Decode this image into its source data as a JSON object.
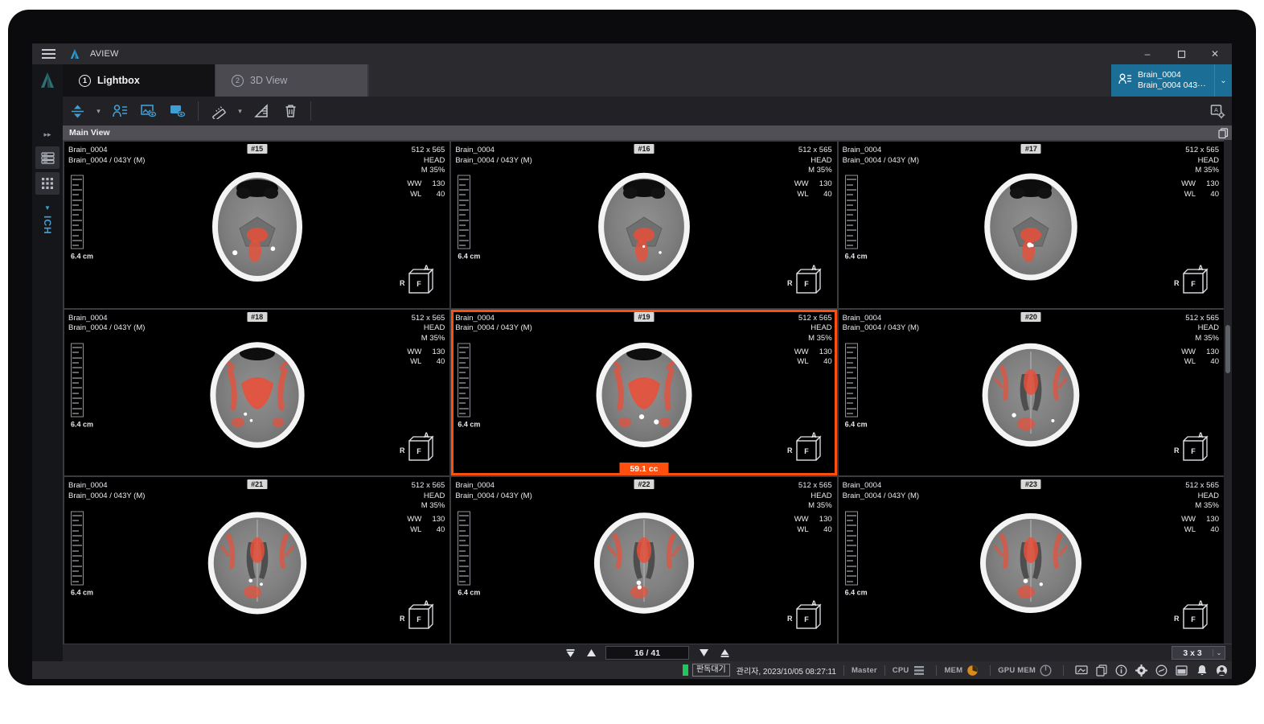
{
  "window": {
    "app_title": "AVIEW",
    "minimize": "–",
    "maximize": "❐",
    "close": "✕"
  },
  "tabs": [
    {
      "num": "1",
      "label": "Lightbox",
      "active": true
    },
    {
      "num": "2",
      "label": "3D View",
      "active": false
    }
  ],
  "patient_badge": {
    "line1": "Brain_0004",
    "line2": "Brain_0004 043···",
    "caret": "⌄"
  },
  "sidebar": {
    "expand": "▸▸",
    "caret": "▼",
    "module_label": "ICH"
  },
  "main_view": {
    "title": "Main View"
  },
  "series_common": {
    "patient_id": "Brain_0004",
    "patient_desc": "Brain_0004 / 043Y (M)",
    "dimensions": "512 x 565",
    "body_part": "HEAD",
    "zoom": "M 35%",
    "ww_label": "WW",
    "ww_value": "130",
    "wl_label": "WL",
    "wl_value": "40",
    "scale_label": "6.4 cm",
    "orient_anterior": "A",
    "orient_right": "R",
    "orient_front": "F"
  },
  "tiles": [
    {
      "slice": "#15",
      "selected": false,
      "volume": null
    },
    {
      "slice": "#16",
      "selected": false,
      "volume": null
    },
    {
      "slice": "#17",
      "selected": false,
      "volume": null
    },
    {
      "slice": "#18",
      "selected": false,
      "volume": null
    },
    {
      "slice": "#19",
      "selected": true,
      "volume": "59.1 cc"
    },
    {
      "slice": "#20",
      "selected": false,
      "volume": null
    },
    {
      "slice": "#21",
      "selected": false,
      "volume": null
    },
    {
      "slice": "#22",
      "selected": false,
      "volume": null
    },
    {
      "slice": "#23",
      "selected": false,
      "volume": null
    }
  ],
  "bottom_nav": {
    "first": "⏮",
    "prev": "▲",
    "counter": "16 / 41",
    "next": "▼",
    "last": "⏭",
    "layout_value": "3 x 3",
    "layout_caret": "⌄"
  },
  "status_bar": {
    "state_badge": "판독대기",
    "user_time": "관리자, 2023/10/05 08:27:11",
    "master": "Master",
    "cpu": "CPU",
    "mem": "MEM",
    "gpu_mem": "GPU MEM"
  },
  "colors": {
    "accent_blue": "#3f9fd4",
    "patient_badge": "#1b6e96",
    "selection_orange": "#ff4f0f",
    "status_green": "#22c55e",
    "mem_orange": "#d98a1f",
    "lesion_red": "#e8503a"
  }
}
